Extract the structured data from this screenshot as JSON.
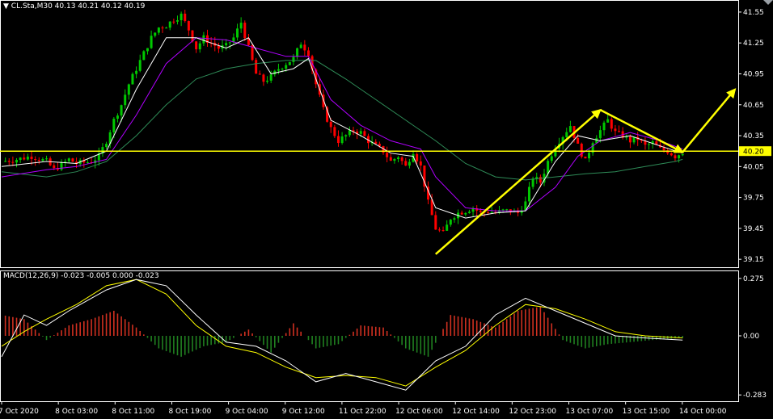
{
  "header": {
    "menu_icon": "triangle-down-icon",
    "symbol": "CL.Sta,M30",
    "ohlc": "40.13 40.21 40.12 40.19"
  },
  "macd_header": "MACD(12,26,9) -0.023 -0.005 0.000 -0.023",
  "colors": {
    "background": "#000000",
    "frame": "#ffffff",
    "bull_candle": "#00c800",
    "bear_candle": "#ff0000",
    "ma_fast": "#ffffff",
    "ma_mid": "#b000ff",
    "ma_slow": "#2e8b57",
    "signal_line": "#ffff00",
    "macd_hist_pos": "#d03020",
    "macd_hist_neg": "#208020",
    "annotation_arrows": "#ffff00",
    "price_tag_bg": "#ffff00",
    "price_tag_text": "#000000"
  },
  "chart_data": [
    {
      "type": "candlestick",
      "title": "CL.Sta,M30",
      "ylim": [
        39.12,
        41.62
      ],
      "y_ticks": [
        "41.55",
        "41.25",
        "40.95",
        "40.65",
        "40.35",
        "40.05",
        "39.75",
        "39.45",
        "39.15"
      ],
      "y_tick_values": [
        41.55,
        41.25,
        40.95,
        40.65,
        40.35,
        40.05,
        39.75,
        39.45,
        39.15
      ],
      "horizontal_line": {
        "value": 40.2,
        "label": "40.20"
      },
      "price_path": [
        [
          0,
          40.1
        ],
        [
          2,
          40.12
        ],
        [
          4,
          40.15
        ],
        [
          6,
          40.1
        ],
        [
          7,
          40.02
        ],
        [
          9,
          40.12
        ],
        [
          10,
          40.08
        ],
        [
          12,
          40.1
        ],
        [
          13,
          40.15
        ],
        [
          14,
          40.3
        ],
        [
          15,
          40.5
        ],
        [
          16,
          40.65
        ],
        [
          17,
          40.85
        ],
        [
          18,
          41.0
        ],
        [
          19,
          41.15
        ],
        [
          20,
          41.3
        ],
        [
          21,
          41.4
        ],
        [
          22,
          41.42
        ],
        [
          23,
          41.48
        ],
        [
          24,
          41.52
        ],
        [
          25,
          41.38
        ],
        [
          26,
          41.2
        ],
        [
          27,
          41.3
        ],
        [
          28,
          41.25
        ],
        [
          29,
          41.2
        ],
        [
          30,
          41.22
        ],
        [
          31,
          41.3
        ],
        [
          32,
          41.45
        ],
        [
          33,
          41.2
        ],
        [
          34,
          40.95
        ],
        [
          35,
          40.88
        ],
        [
          36,
          40.92
        ],
        [
          37,
          41.0
        ],
        [
          38,
          41.05
        ],
        [
          39,
          41.1
        ],
        [
          40,
          41.25
        ],
        [
          41,
          41.15
        ],
        [
          42,
          40.85
        ],
        [
          43,
          40.6
        ],
        [
          44,
          40.42
        ],
        [
          45,
          40.3
        ],
        [
          46,
          40.35
        ],
        [
          47,
          40.4
        ],
        [
          48,
          40.38
        ],
        [
          49,
          40.3
        ],
        [
          50,
          40.25
        ],
        [
          51,
          40.2
        ],
        [
          52,
          40.1
        ],
        [
          53,
          40.15
        ],
        [
          54,
          40.05
        ],
        [
          55,
          40.2
        ],
        [
          56,
          40.05
        ],
        [
          57,
          39.7
        ],
        [
          58,
          39.45
        ],
        [
          59,
          39.4
        ],
        [
          60,
          39.55
        ],
        [
          61,
          39.6
        ],
        [
          62,
          39.62
        ],
        [
          63,
          39.65
        ],
        [
          64,
          39.6
        ],
        [
          65,
          39.62
        ],
        [
          66,
          39.6
        ],
        [
          67,
          39.62
        ],
        [
          68,
          39.62
        ],
        [
          69,
          39.6
        ],
        [
          70,
          39.7
        ],
        [
          71,
          39.95
        ],
        [
          72,
          39.9
        ],
        [
          73,
          40.1
        ],
        [
          74,
          40.25
        ],
        [
          75,
          40.35
        ],
        [
          76,
          40.45
        ],
        [
          77,
          40.25
        ],
        [
          78,
          40.1
        ],
        [
          79,
          40.3
        ],
        [
          80,
          40.4
        ],
        [
          81,
          40.5
        ],
        [
          82,
          40.38
        ],
        [
          83,
          40.35
        ],
        [
          84,
          40.3
        ],
        [
          85,
          40.32
        ],
        [
          86,
          40.25
        ],
        [
          87,
          40.28
        ],
        [
          88,
          40.22
        ],
        [
          89,
          40.2
        ],
        [
          90,
          40.15
        ],
        [
          91,
          40.19
        ]
      ],
      "ma_fast_path": [
        [
          0,
          40.05
        ],
        [
          6,
          40.1
        ],
        [
          10,
          40.08
        ],
        [
          14,
          40.2
        ],
        [
          18,
          40.8
        ],
        [
          22,
          41.3
        ],
        [
          26,
          41.3
        ],
        [
          30,
          41.2
        ],
        [
          33,
          41.3
        ],
        [
          36,
          40.95
        ],
        [
          39,
          41.0
        ],
        [
          41,
          41.1
        ],
        [
          44,
          40.5
        ],
        [
          48,
          40.35
        ],
        [
          52,
          40.18
        ],
        [
          55,
          40.15
        ],
        [
          58,
          39.65
        ],
        [
          62,
          39.55
        ],
        [
          66,
          39.6
        ],
        [
          70,
          39.62
        ],
        [
          74,
          40.1
        ],
        [
          77,
          40.35
        ],
        [
          80,
          40.3
        ],
        [
          84,
          40.35
        ],
        [
          88,
          40.25
        ],
        [
          91,
          40.18
        ]
      ],
      "ma_mid_path": [
        [
          0,
          39.95
        ],
        [
          6,
          40.02
        ],
        [
          10,
          40.05
        ],
        [
          14,
          40.12
        ],
        [
          18,
          40.55
        ],
        [
          22,
          41.05
        ],
        [
          26,
          41.3
        ],
        [
          30,
          41.28
        ],
        [
          34,
          41.2
        ],
        [
          38,
          41.12
        ],
        [
          41,
          41.12
        ],
        [
          44,
          40.7
        ],
        [
          48,
          40.45
        ],
        [
          52,
          40.3
        ],
        [
          56,
          40.22
        ],
        [
          58,
          39.95
        ],
        [
          62,
          39.65
        ],
        [
          66,
          39.62
        ],
        [
          70,
          39.62
        ],
        [
          74,
          39.85
        ],
        [
          77,
          40.15
        ],
        [
          80,
          40.3
        ],
        [
          84,
          40.38
        ],
        [
          88,
          40.3
        ],
        [
          91,
          40.22
        ]
      ],
      "ma_slow_path": [
        [
          0,
          40.0
        ],
        [
          6,
          39.95
        ],
        [
          10,
          40.0
        ],
        [
          14,
          40.1
        ],
        [
          18,
          40.35
        ],
        [
          22,
          40.65
        ],
        [
          26,
          40.9
        ],
        [
          30,
          41.0
        ],
        [
          34,
          41.05
        ],
        [
          38,
          41.08
        ],
        [
          42,
          41.08
        ],
        [
          46,
          40.9
        ],
        [
          50,
          40.7
        ],
        [
          54,
          40.5
        ],
        [
          58,
          40.3
        ],
        [
          62,
          40.08
        ],
        [
          66,
          39.95
        ],
        [
          70,
          39.92
        ],
        [
          74,
          39.95
        ],
        [
          78,
          39.98
        ],
        [
          82,
          40.0
        ],
        [
          86,
          40.05
        ],
        [
          90,
          40.1
        ],
        [
          91,
          40.12
        ]
      ],
      "annotations": [
        {
          "type": "arrow",
          "from": [
            58,
            39.2
          ],
          "to": [
            80,
            40.6
          ]
        },
        {
          "type": "arrow",
          "from": [
            80,
            40.6
          ],
          "to": [
            91,
            40.19
          ]
        },
        {
          "type": "arrow",
          "from": [
            91,
            40.19
          ],
          "to": [
            98,
            40.8
          ]
        }
      ],
      "x_ticks": [
        {
          "label": "7 Oct 2020",
          "pos": 0
        },
        {
          "label": "8 Oct 03:00",
          "pos": 9
        },
        {
          "label": "8 Oct 11:00",
          "pos": 18
        },
        {
          "label": "8 Oct 19:00",
          "pos": 27
        },
        {
          "label": "9 Oct 04:00",
          "pos": 36
        },
        {
          "label": "9 Oct 12:00",
          "pos": 45
        },
        {
          "label": "11 Oct 22:00",
          "pos": 54
        },
        {
          "label": "12 Oct 06:00",
          "pos": 63
        },
        {
          "label": "12 Oct 14:00",
          "pos": 72
        },
        {
          "label": "12 Oct 23:00",
          "pos": 81
        },
        {
          "label": "13 Oct 07:00",
          "pos": 90
        },
        {
          "label": "13 Oct 15:00",
          "pos": 99
        },
        {
          "label": "14 Oct 00:00",
          "pos": 108
        }
      ]
    },
    {
      "type": "macd",
      "title": "MACD(12,26,9) -0.023 -0.005 0.000 -0.023",
      "ylim": [
        -0.29,
        0.29
      ],
      "y_ticks": [
        "0.275",
        "0.00",
        "-0.283"
      ],
      "y_tick_values": [
        0.275,
        0.0,
        -0.283
      ],
      "histogram_path": [
        [
          0,
          0.1
        ],
        [
          3,
          0.08
        ],
        [
          6,
          -0.02
        ],
        [
          9,
          0.05
        ],
        [
          12,
          0.08
        ],
        [
          15,
          0.12
        ],
        [
          18,
          0.04
        ],
        [
          21,
          -0.06
        ],
        [
          24,
          -0.1
        ],
        [
          27,
          -0.05
        ],
        [
          30,
          -0.03
        ],
        [
          33,
          0.03
        ],
        [
          36,
          -0.08
        ],
        [
          39,
          0.06
        ],
        [
          42,
          -0.06
        ],
        [
          45,
          -0.04
        ],
        [
          48,
          0.05
        ],
        [
          51,
          0.04
        ],
        [
          54,
          -0.06
        ],
        [
          57,
          -0.1
        ],
        [
          60,
          0.1
        ],
        [
          63,
          0.08
        ],
        [
          66,
          0.04
        ],
        [
          69,
          0.12
        ],
        [
          72,
          0.14
        ],
        [
          75,
          -0.02
        ],
        [
          78,
          -0.06
        ],
        [
          81,
          -0.04
        ],
        [
          84,
          -0.03
        ],
        [
          87,
          -0.02
        ],
        [
          91,
          -0.01
        ]
      ],
      "macd_path": [
        [
          0,
          -0.1
        ],
        [
          3,
          0.1
        ],
        [
          6,
          0.05
        ],
        [
          9,
          0.12
        ],
        [
          14,
          0.22
        ],
        [
          18,
          0.27
        ],
        [
          22,
          0.24
        ],
        [
          26,
          0.1
        ],
        [
          30,
          -0.03
        ],
        [
          34,
          -0.05
        ],
        [
          38,
          -0.12
        ],
        [
          42,
          -0.22
        ],
        [
          46,
          -0.18
        ],
        [
          50,
          -0.22
        ],
        [
          54,
          -0.26
        ],
        [
          58,
          -0.12
        ],
        [
          62,
          -0.05
        ],
        [
          66,
          0.1
        ],
        [
          70,
          0.18
        ],
        [
          74,
          0.12
        ],
        [
          78,
          0.06
        ],
        [
          82,
          0.0
        ],
        [
          86,
          -0.01
        ],
        [
          91,
          -0.02
        ]
      ],
      "signal_path": [
        [
          0,
          -0.05
        ],
        [
          3,
          0.02
        ],
        [
          6,
          0.08
        ],
        [
          10,
          0.15
        ],
        [
          14,
          0.24
        ],
        [
          18,
          0.27
        ],
        [
          22,
          0.2
        ],
        [
          26,
          0.05
        ],
        [
          30,
          -0.05
        ],
        [
          34,
          -0.08
        ],
        [
          38,
          -0.15
        ],
        [
          42,
          -0.2
        ],
        [
          46,
          -0.19
        ],
        [
          50,
          -0.2
        ],
        [
          54,
          -0.24
        ],
        [
          58,
          -0.15
        ],
        [
          62,
          -0.07
        ],
        [
          66,
          0.05
        ],
        [
          70,
          0.15
        ],
        [
          74,
          0.13
        ],
        [
          78,
          0.08
        ],
        [
          82,
          0.02
        ],
        [
          86,
          0.0
        ],
        [
          91,
          -0.01
        ]
      ]
    }
  ]
}
